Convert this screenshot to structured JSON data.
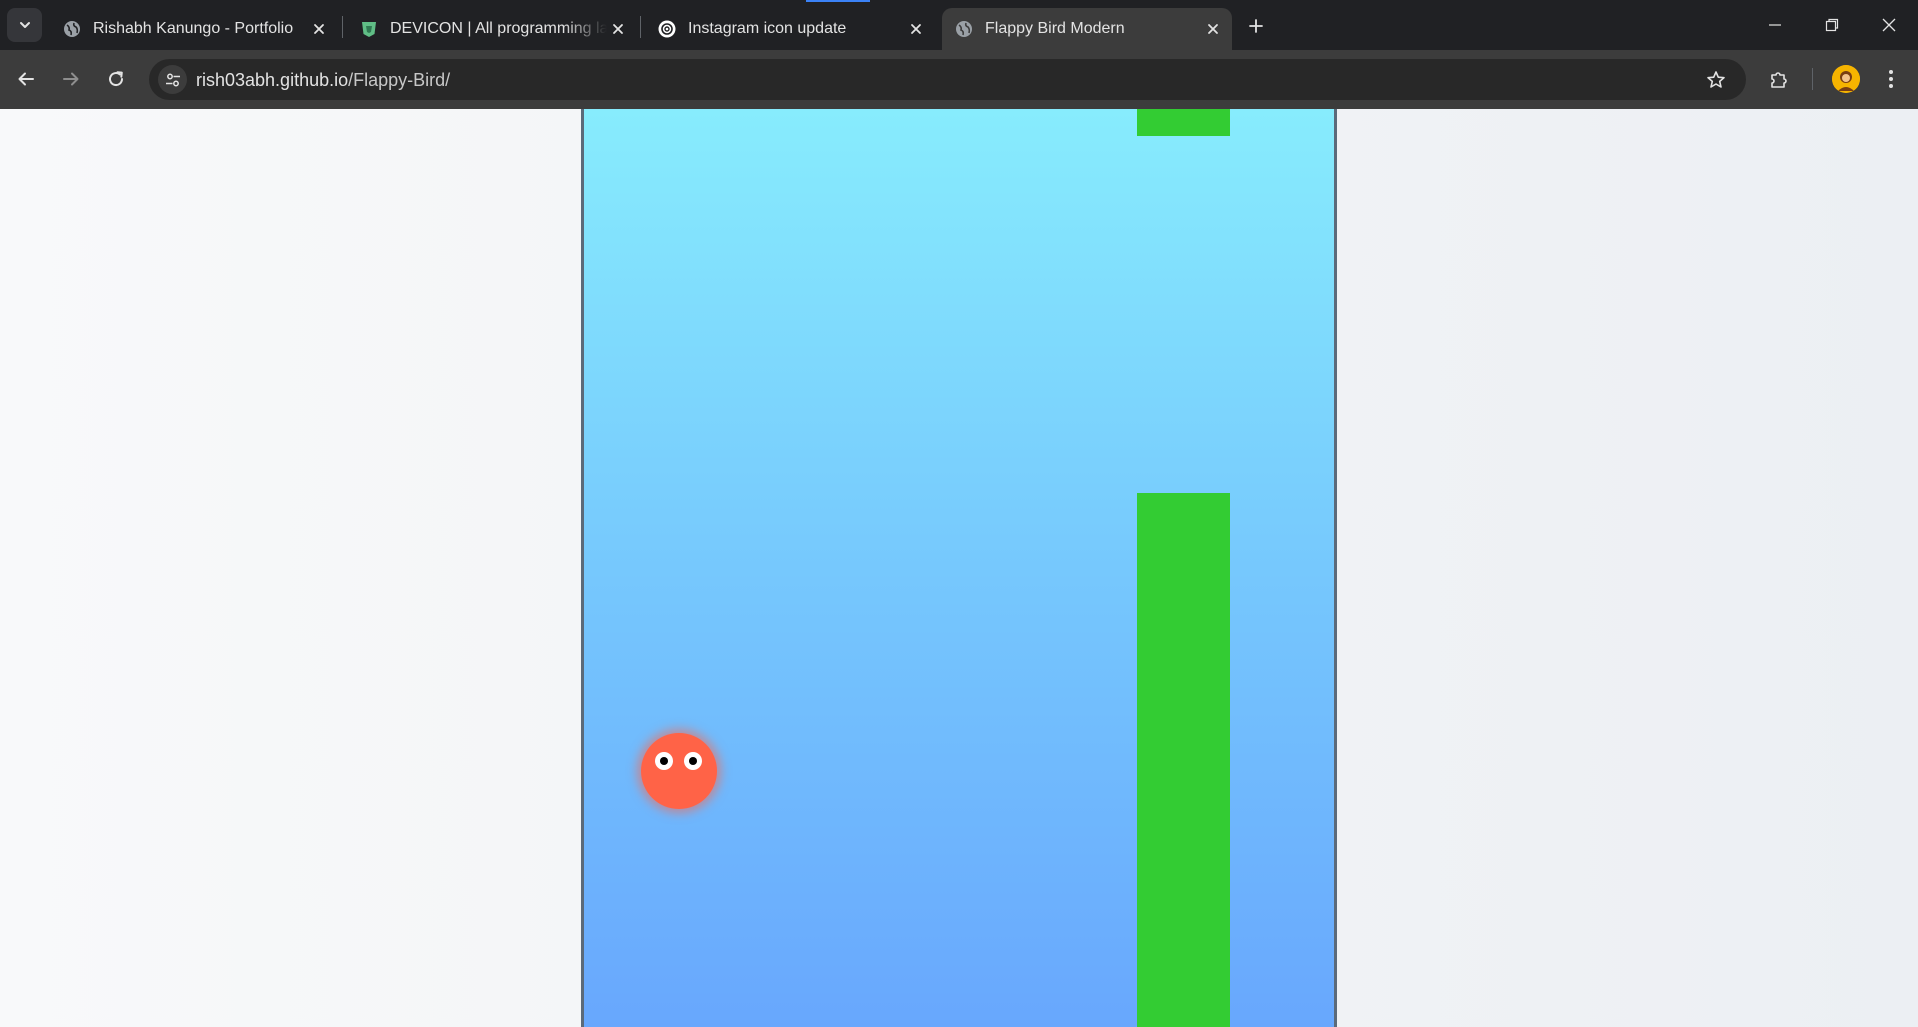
{
  "browser": {
    "tabs": [
      {
        "title": "Rishabh Kanungo - Portfolio",
        "icon": "globe-icon",
        "active": false
      },
      {
        "title": "DEVICON | All programming lan",
        "icon": "devicon-shield-icon",
        "active": false
      },
      {
        "title": "Instagram icon update",
        "icon": "openai-icon",
        "active": false
      },
      {
        "title": "Flappy Bird Modern",
        "icon": "globe-icon",
        "active": true
      }
    ],
    "address_bar": {
      "host": "rish03abh.github.io",
      "path": "/Flappy-Bird/"
    }
  },
  "game": {
    "sky_colors": [
      "#87ecfd",
      "#68a7fd"
    ],
    "pipe_color": "#33cc33",
    "bird_color": "#ff6347"
  },
  "colors": {
    "tab_strip": "#202124",
    "toolbar": "#3c3c3c",
    "omnibox": "#282828"
  }
}
